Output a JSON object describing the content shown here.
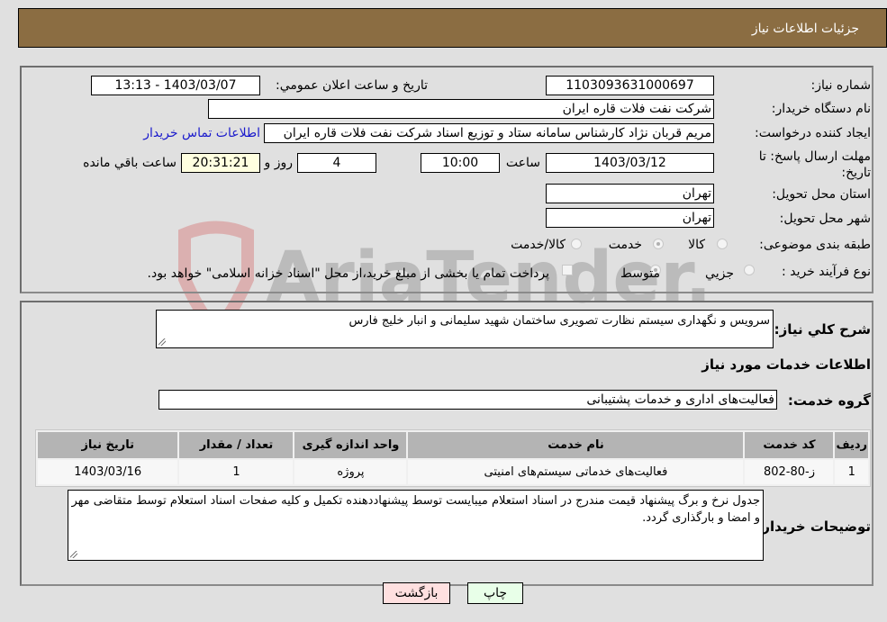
{
  "header": {
    "title": "جزئیات اطلاعات نیاز"
  },
  "form": {
    "need_number": {
      "label": "شماره نیاز:",
      "value": "1103093631000697"
    },
    "announce_datetime": {
      "label": "تاریخ و ساعت اعلان عمومي:",
      "value": "1403/03/07 - 13:13"
    },
    "buyer_org": {
      "label": "نام دستگاه خریدار:",
      "value": "شرکت نفت فلات قاره ایران",
      "extra_value": ""
    },
    "creator": {
      "label": "ایجاد کننده درخواست:",
      "value": "مریم قربان نژاد کارشناس سامانه ستاد و توزیع اسناد شرکت نفت فلات قاره ایران",
      "contact_link": "اطلاعات تماس خریدار"
    },
    "deadline": {
      "label": "مهلت ارسال پاسخ: تا تاریخ:",
      "date": "1403/03/12",
      "time_label": "ساعت",
      "time": "10:00",
      "days": "4",
      "days_label": "روز و",
      "remaining": "20:31:21",
      "remaining_label": "ساعت باقي مانده"
    },
    "province": {
      "label": "استان محل تحویل:",
      "value": "تهران"
    },
    "city": {
      "label": "شهر محل تحویل:",
      "value": "تهران"
    },
    "category": {
      "label": "طبقه بندی موضوعی:",
      "options": [
        {
          "label": "کالا",
          "checked": false
        },
        {
          "label": "خدمت",
          "checked": true
        },
        {
          "label": "کالا/خدمت",
          "checked": false
        }
      ]
    },
    "purchase_type": {
      "label": "نوع فرآیند خرید :",
      "options": [
        {
          "label": "جزيي",
          "checked": false
        },
        {
          "label": "متوسط",
          "checked": true
        }
      ],
      "treasury_checkbox_label": "پرداخت تمام یا بخشی از مبلغ خرید،از محل \"اسناد خزانه اسلامی\" خواهد بود.",
      "treasury_checked": false
    }
  },
  "details": {
    "description_label": "شرح کلي نیاز:",
    "description": "سرویس و نگهداری سیستم نظارت تصویری ساختمان شهید سلیمانی و انبار خلیج فارس",
    "services_heading": "اطلاعات خدمات مورد نیاز",
    "service_group_label": "گروه خدمت:",
    "service_group": "فعالیت‌های اداری و خدمات پشتیبانی",
    "table": {
      "headers": [
        "ردیف",
        "کد خدمت",
        "نام خدمت",
        "واحد اندازه گیری",
        "تعداد / مقدار",
        "تاریخ نیاز"
      ],
      "rows": [
        [
          "1",
          "ز-80-802",
          "فعالیت‌های خدماتی سیستم‌های امنیتی",
          "پروژه",
          "1",
          "1403/03/16"
        ]
      ]
    },
    "buyer_notes_label": "توضیحات خریدار:",
    "buyer_notes": "جدول نرخ و برگ پیشنهاد قیمت مندرج در اسناد استعلام میبایست توسط پیشنهاددهنده تکمیل و کلیه صفحات اسناد استعلام توسط متقاضی مهر و امضا و بارگذاری گردد."
  },
  "buttons": {
    "print": "چاپ",
    "back": "بازگشت"
  },
  "watermark": {
    "text": "AriaTender.neT"
  },
  "colors": {
    "header_bg": "#8b6d42",
    "link": "#1a1acc",
    "print_bg": "#e8ffe8",
    "back_bg": "#ffe0e0",
    "remaining_bg": "#ffffe0"
  }
}
